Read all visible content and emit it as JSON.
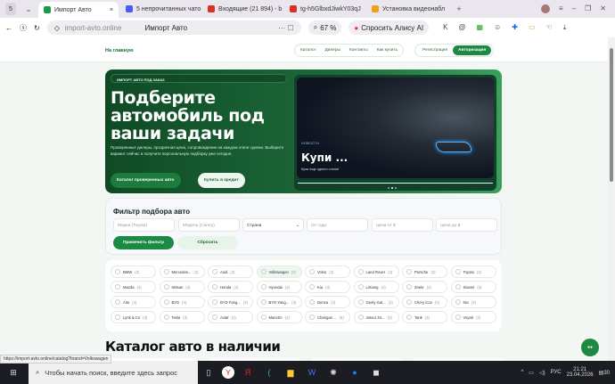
{
  "browser": {
    "tab_count": "5",
    "tabs": [
      {
        "label": "Импорт Авто",
        "color": "#1c9b47",
        "active": true
      },
      {
        "label": "5 непрочитанных чато",
        "color": "#4a5cf0"
      },
      {
        "label": "Входящие (21 894) - b",
        "color": "#d93025"
      },
      {
        "label": "tg-h5GlbxdJiwkY03qJ",
        "color": "#d93025"
      },
      {
        "label": "Установка видеонабл",
        "color": "#f0a020"
      }
    ],
    "url": "import-avto.online",
    "page_title": "Импорт Авто",
    "zoom": "67 %",
    "alice": "Спросить Алису AI"
  },
  "header": {
    "home": "На главную",
    "nav": [
      "Каталог",
      "Дилеры",
      "Контакты",
      "Как купить"
    ],
    "register": "Регистрация",
    "login": "Авторизация"
  },
  "hero": {
    "badge": "ИМПОРТ АВТО ПОД ЗАКАЗ",
    "title": "Подберите автомобиль под ваши задачи",
    "description": "Проверенные дилеры, прозрачная цена, сопровождение на каждом этапе сделки. Выберите вариант сейчас и получите персональную подборку уже сегодня.",
    "catalog_button": "Каталог проверенных авто",
    "credit_button": "Купить в кредит",
    "slide": {
      "tag": "НОВОСТИ",
      "title": "Купи ...",
      "subtitle": "Купи еще одного слона!",
      "active_dot": 2,
      "dots": 3
    }
  },
  "filter": {
    "title": "Фильтр подбора авто",
    "brand_placeholder": "Марка (Toyota)",
    "model_placeholder": "Модель (Camry)",
    "country": "Страна",
    "year_placeholder": "От года",
    "price_from_placeholder": "Цена от $",
    "price_to_placeholder": "Цена до $",
    "apply": "Применить фильтр",
    "reset": "Сбросить"
  },
  "brands": [
    {
      "name": "BMW",
      "count": "(3)"
    },
    {
      "name": "Mercedes...",
      "count": "(3)"
    },
    {
      "name": "Audi",
      "count": "(3)"
    },
    {
      "name": "Volkswagen",
      "count": "(3)",
      "selected": true
    },
    {
      "name": "Volvo",
      "count": "(3)"
    },
    {
      "name": "Land Rover",
      "count": "(3)"
    },
    {
      "name": "Porsche",
      "count": "(3)"
    },
    {
      "name": "Toyota",
      "count": "(3)"
    },
    {
      "name": "Mazda",
      "count": "(3)"
    },
    {
      "name": "Nissan",
      "count": "(3)"
    },
    {
      "name": "Honda",
      "count": "(3)"
    },
    {
      "name": "Hyundai",
      "count": "(3)"
    },
    {
      "name": "Kia",
      "count": "(3)"
    },
    {
      "name": "LiXiang",
      "count": "(3)"
    },
    {
      "name": "Zeekr",
      "count": "(3)"
    },
    {
      "name": "Xiaomi",
      "count": "(3)"
    },
    {
      "name": "Aito",
      "count": "(3)"
    },
    {
      "name": "BYD",
      "count": "(3)"
    },
    {
      "name": "BYD Fang...",
      "count": "(3)"
    },
    {
      "name": "BYD Yang...",
      "count": "(3)"
    },
    {
      "name": "Denza",
      "count": "(3)"
    },
    {
      "name": "Geely Gal...",
      "count": "(3)"
    },
    {
      "name": "Chery iCar",
      "count": "(3)"
    },
    {
      "name": "Nio",
      "count": "(3)"
    },
    {
      "name": "Lynk & Co",
      "count": "(3)"
    },
    {
      "name": "Tesla",
      "count": "(3)"
    },
    {
      "name": "Avatr",
      "count": "(3)"
    },
    {
      "name": "Maextro",
      "count": "(3)"
    },
    {
      "name": "Changan ...",
      "count": "(3)"
    },
    {
      "name": "Jetour Zo...",
      "count": "(3)"
    },
    {
      "name": "Tank",
      "count": "(3)"
    },
    {
      "name": "Voyah",
      "count": "(3)"
    }
  ],
  "catalog": {
    "title": "Каталог авто в наличии"
  },
  "status_url": "https://import-avto.online/catalog?brand=Volkswagen",
  "taskbar": {
    "search_placeholder": "Чтобы начать поиск, введите здесь запрос",
    "lang": "РУС",
    "time": "21:21",
    "date": "23.04.2026",
    "notifications": "30"
  }
}
